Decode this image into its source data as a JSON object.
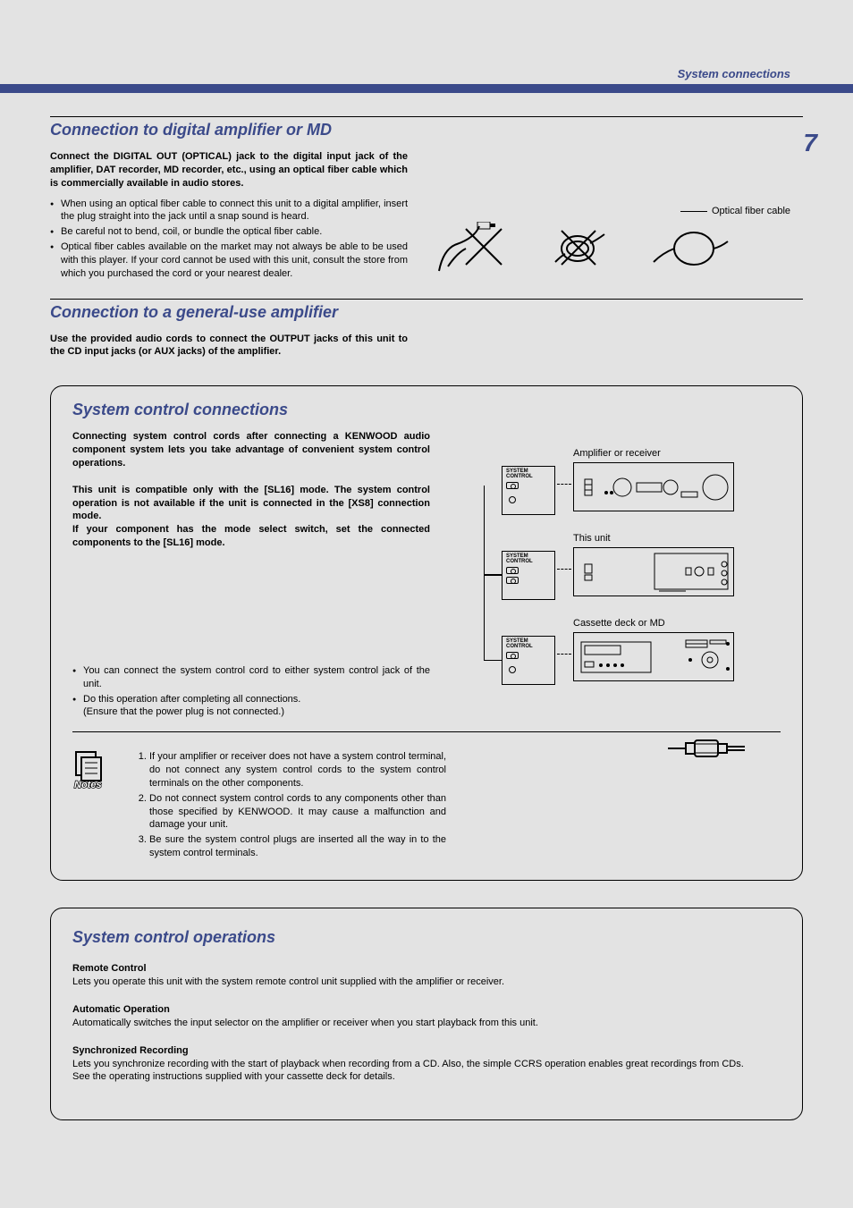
{
  "header": {
    "category": "System connections",
    "page": "7"
  },
  "s1": {
    "title": "Connection to digital amplifier or MD",
    "intro": "Connect the DIGITAL OUT (OPTICAL) jack to the digital input jack of the amplifier, DAT recorder, MD recorder, etc., using an optical fiber cable which is commercially available in audio stores.",
    "b1": "When using an optical fiber cable to connect this unit to a digital amplifier, insert the plug straight into the jack until a snap sound is heard.",
    "b2": "Be careful not to bend, coil, or bundle the optical fiber cable.",
    "b3": "Optical fiber cables available on the market may not always be able to be used with this player. If your cord cannot be used with this unit, consult the store from which you purchased the cord or your nearest dealer.",
    "fiber_label": "Optical fiber cable"
  },
  "s2": {
    "title": "Connection to a general-use amplifier",
    "intro": "Use the provided audio cords to connect the OUTPUT jacks of this unit to the CD input jacks (or AUX jacks) of the amplifier."
  },
  "s3": {
    "title": "System control connections",
    "p1": "Connecting system control cords after connecting a KENWOOD audio component system lets you take advantage of convenient system control operations.",
    "p2": "This unit is compatible only with the [SL16] mode. The system control operation is not available if the unit is connected in the [XS8] connection mode.",
    "p3": "If your component has the mode select switch, set the connected components to the [SL16] mode.",
    "b1": "You can connect the system control cord to either system control jack of the unit.",
    "b2": "Do this operation after completing all connections.",
    "b2s": "(Ensure that the power plug is not connected.)",
    "labels": {
      "sc": "SYSTEM CONTROL",
      "amp": "Amplifier or receiver",
      "unit": "This unit",
      "deck": "Cassette deck or MD"
    },
    "notes_label": "Notes",
    "n1": "If your amplifier or receiver does not have a system control terminal, do not connect any system control cords to the system control terminals on the other components.",
    "n2": "Do not connect system control cords to any components other than those specified by KENWOOD. It may cause a malfunction and damage your unit.",
    "n3": "Be sure the system control plugs are inserted all the way in to the system control terminals."
  },
  "s4": {
    "title": "System control operations",
    "h1": "Remote Control",
    "p1": "Lets you operate this unit with the system remote control unit supplied with the amplifier or receiver.",
    "h2": "Automatic Operation",
    "p2": "Automatically switches the input selector on the amplifier or receiver when you start playback from this unit.",
    "h3": "Synchronized Recording",
    "p3a": "Lets you synchronize recording with the start of playback when recording from a CD. Also, the simple CCRS operation enables great recordings from CDs.",
    "p3b": "See the operating instructions supplied with your cassette deck for details."
  }
}
